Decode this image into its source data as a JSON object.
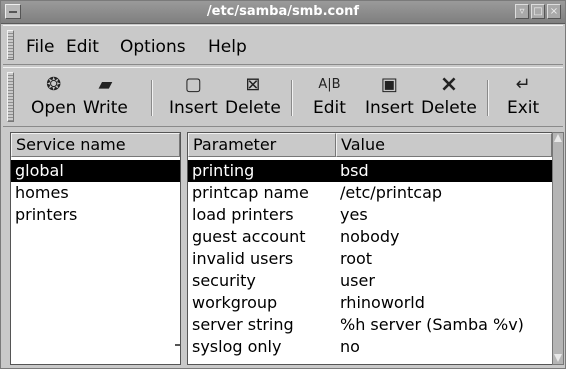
{
  "window": {
    "title": "/etc/samba/smb.conf"
  },
  "menubar": {
    "items": [
      "File",
      "Edit",
      "Options",
      "Help"
    ]
  },
  "toolbar": {
    "buttons": [
      {
        "label": "Open",
        "icon": "open-icon",
        "glyph": "❂"
      },
      {
        "label": "Write",
        "icon": "floppy-icon",
        "glyph": "▰"
      },
      {
        "label": "Insert",
        "icon": "insert-service-icon",
        "glyph": "▢"
      },
      {
        "label": "Delete",
        "icon": "delete-service-icon",
        "glyph": "⊠"
      },
      {
        "label": "Edit",
        "icon": "edit-icon",
        "glyph": "A|B"
      },
      {
        "label": "Insert",
        "icon": "insert-param-icon",
        "glyph": "▣"
      },
      {
        "label": "Delete",
        "icon": "delete-param-icon",
        "glyph": "×"
      },
      {
        "label": "Exit",
        "icon": "exit-icon",
        "glyph": "↵"
      }
    ]
  },
  "services": {
    "header": "Service name",
    "items": [
      "global",
      "homes",
      "printers"
    ],
    "selected_index": 0
  },
  "parameters": {
    "headers": {
      "parameter": "Parameter",
      "value": "Value"
    },
    "rows": [
      {
        "parameter": "printing",
        "value": "bsd"
      },
      {
        "parameter": "printcap name",
        "value": "/etc/printcap"
      },
      {
        "parameter": "load printers",
        "value": "yes"
      },
      {
        "parameter": "guest account",
        "value": "nobody"
      },
      {
        "parameter": "invalid users",
        "value": "root"
      },
      {
        "parameter": "security",
        "value": "user"
      },
      {
        "parameter": "workgroup",
        "value": "rhinoworld"
      },
      {
        "parameter": "server string",
        "value": "%h server (Samba %v)"
      },
      {
        "parameter": "syslog only",
        "value": "no"
      }
    ],
    "selected_index": 0
  }
}
